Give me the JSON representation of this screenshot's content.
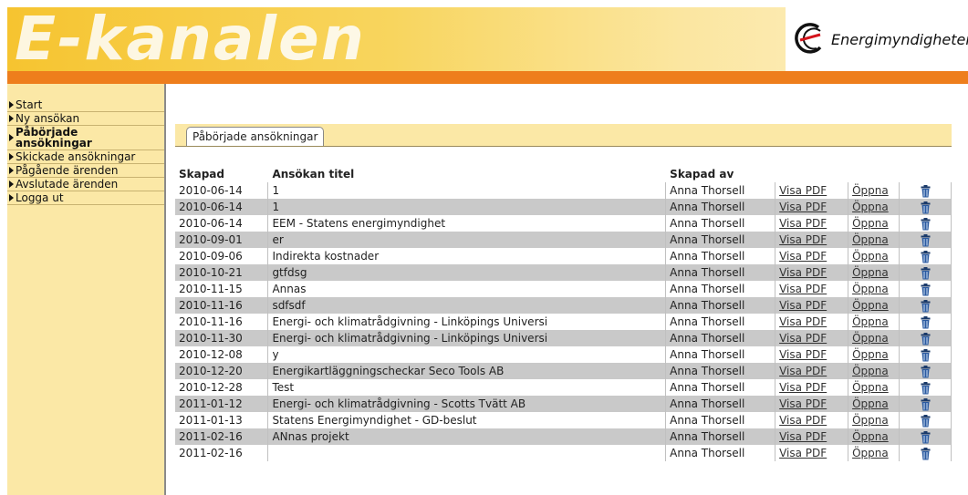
{
  "header": {
    "brand": "E-kanalen",
    "logo_text": "Energimyndigheten"
  },
  "sidebar": {
    "items": [
      {
        "label": "Start",
        "active": false
      },
      {
        "label": "Ny ansökan",
        "active": false
      },
      {
        "label": "Påbörjade ansökningar",
        "active": true
      },
      {
        "label": "Skickade ansökningar",
        "active": false
      },
      {
        "label": "Pågående ärenden",
        "active": false
      },
      {
        "label": "Avslutade ärenden",
        "active": false
      },
      {
        "label": "Logga ut",
        "active": false
      }
    ]
  },
  "tab": {
    "label": "Påbörjade ansökningar"
  },
  "table": {
    "headers": [
      "Skapad",
      "Ansökan titel",
      "Skapad av",
      "",
      "",
      ""
    ],
    "visa_pdf_label": "Visa PDF",
    "oppna_label": "Öppna",
    "rows": [
      {
        "date": "2010-06-14",
        "title": "1",
        "by": "Anna Thorsell"
      },
      {
        "date": "2010-06-14",
        "title": "1",
        "by": "Anna Thorsell"
      },
      {
        "date": "2010-06-14",
        "title": "EEM - Statens energimyndighet",
        "by": "Anna Thorsell"
      },
      {
        "date": "2010-09-01",
        "title": "er",
        "by": "Anna Thorsell"
      },
      {
        "date": "2010-09-06",
        "title": "Indirekta kostnader",
        "by": "Anna Thorsell"
      },
      {
        "date": "2010-10-21",
        "title": "gtfdsg",
        "by": "Anna Thorsell"
      },
      {
        "date": "2010-11-15",
        "title": "Annas",
        "by": "Anna Thorsell"
      },
      {
        "date": "2010-11-16",
        "title": "sdfsdf",
        "by": "Anna Thorsell"
      },
      {
        "date": "2010-11-16",
        "title": "Energi- och klimatrådgivning - Linköpings Universi",
        "by": "Anna Thorsell"
      },
      {
        "date": "2010-11-30",
        "title": "Energi- och klimatrådgivning - Linköpings Universi",
        "by": "Anna Thorsell"
      },
      {
        "date": "2010-12-08",
        "title": "y",
        "by": "Anna Thorsell"
      },
      {
        "date": "2010-12-20",
        "title": "Energikartläggningscheckar Seco Tools AB",
        "by": "Anna Thorsell"
      },
      {
        "date": "2010-12-28",
        "title": "Test",
        "by": "Anna Thorsell"
      },
      {
        "date": "2011-01-12",
        "title": "Energi- och klimatrådgivning - Scotts Tvätt AB",
        "by": "Anna Thorsell"
      },
      {
        "date": "2011-01-13",
        "title": "Statens Energimyndighet - GD-beslut",
        "by": "Anna Thorsell"
      },
      {
        "date": "2011-02-16",
        "title": "ANnas projekt",
        "by": "Anna Thorsell"
      },
      {
        "date": "2011-02-16",
        "title": "",
        "by": "Anna Thorsell"
      }
    ]
  },
  "colors": {
    "header_yellow": "#f6c430",
    "orange_bar": "#ee7e1c",
    "sidebar_bg": "#fbe8a6",
    "row_alt": "#c9c9c9",
    "trash_icon": "#1a3a6a"
  },
  "icons": {
    "logo": "energimyndigheten-logo-icon",
    "nav_bullet": "triangle-right-icon",
    "delete": "trash-icon"
  }
}
